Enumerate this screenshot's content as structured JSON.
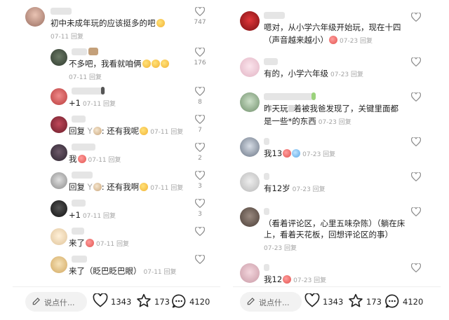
{
  "left": {
    "comments": [
      {
        "text": "初中未成年玩的应该挺多的吧",
        "time": "07-11",
        "reply": "回复",
        "likes": "747"
      },
      {
        "text": "不多吧，我看就咱俩",
        "time": "07-11",
        "reply": "回复",
        "likes": "176"
      },
      {
        "text": "+1",
        "time": "07-11",
        "reply": "回复",
        "likes": "8"
      },
      {
        "prefix": "回复 ",
        "target": "Y",
        "after": ": 还有我呢",
        "time": "07-11",
        "reply": "回复",
        "likes": "7"
      },
      {
        "text": "我",
        "time": "07-11",
        "reply": "回复",
        "likes": "2"
      },
      {
        "prefix": "回复 ",
        "target": "Y",
        "after": ": 还有我啊",
        "time": "07-11",
        "reply": "回复",
        "likes": "3"
      },
      {
        "text": "+1",
        "time": "07-11",
        "reply": "回复",
        "likes": "3"
      },
      {
        "text": "来了",
        "time": "07-11",
        "reply": "回复",
        "likes": ""
      },
      {
        "text": "来了（眨巴眨巴眼）",
        "time": "07-11",
        "reply": "回复",
        "likes": ""
      }
    ]
  },
  "right": {
    "comments": [
      {
        "text": "嗯对，从小学六年级开始玩，现在十四",
        "text2": "（声音越来越小）",
        "time": "07-23",
        "reply": "回复"
      },
      {
        "text": "有的，小学六年级",
        "time": "07-23",
        "reply": "回复"
      },
      {
        "text": "昨天玩",
        "text_b": "着被我爸发现了，关键里面都",
        "text2": "是一些*的东西",
        "time": "07-23",
        "reply": "回复"
      },
      {
        "text": "我13",
        "time": "07-23",
        "reply": "回复"
      },
      {
        "text": "有12岁",
        "time": "07-23",
        "reply": "回复"
      },
      {
        "text": "（看着评论区，心里五味杂陈）（躺在床",
        "text2": "上，看着天花板，回想评论区的事）",
        "time": "07-23",
        "reply": "回复"
      },
      {
        "text": "我12",
        "time": "07-23",
        "reply": "回复"
      }
    ]
  },
  "bottom": {
    "placeholder": "说点什...",
    "likes": "1343",
    "favorites": "173",
    "comments": "4120"
  },
  "colors": {
    "meta": "#a4a4a4",
    "like_count": "#8c8c8c"
  }
}
